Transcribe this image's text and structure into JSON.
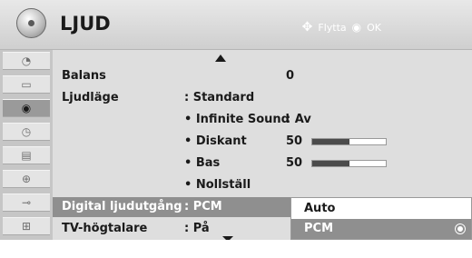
{
  "header": {
    "title": "LJUD",
    "hint_move_icon": "move-cross-icon",
    "hint_move": "Flytta",
    "hint_ok_icon": "ok-radio-icon",
    "hint_ok": "OK"
  },
  "sidebar": {
    "items": [
      {
        "icon": "satellite-dish-icon",
        "glyph": "◔"
      },
      {
        "icon": "picture-icon",
        "glyph": "▭"
      },
      {
        "icon": "audio-disc-icon",
        "glyph": "◉"
      },
      {
        "icon": "clock-icon",
        "glyph": "◷"
      },
      {
        "icon": "calendar-icon",
        "glyph": "▤"
      },
      {
        "icon": "lock-icon",
        "glyph": "⊕"
      },
      {
        "icon": "input-plug-icon",
        "glyph": "⊸"
      },
      {
        "icon": "usb-icon",
        "glyph": "⊞"
      }
    ],
    "selected_index": 2
  },
  "menu": {
    "balans_label": "Balans",
    "balans_value": "0",
    "ljudlage_label": "Ljudläge",
    "ljudlage_value": ": Standard",
    "infinite_label": "• Infinite Sound",
    "infinite_value": ": Av",
    "diskant_label": "• Diskant",
    "diskant_value": "50",
    "diskant_level": 0.5,
    "bas_label": "• Bas",
    "bas_value": "50",
    "bas_level": 0.5,
    "nollstall_label": "• Nollställ",
    "digital_label": "Digital ljudutgång",
    "digital_value": ": PCM",
    "tv_label": "TV-högtalare",
    "tv_value": ": På"
  },
  "popup": {
    "options": [
      "Auto",
      "PCM"
    ],
    "selected": "PCM"
  }
}
